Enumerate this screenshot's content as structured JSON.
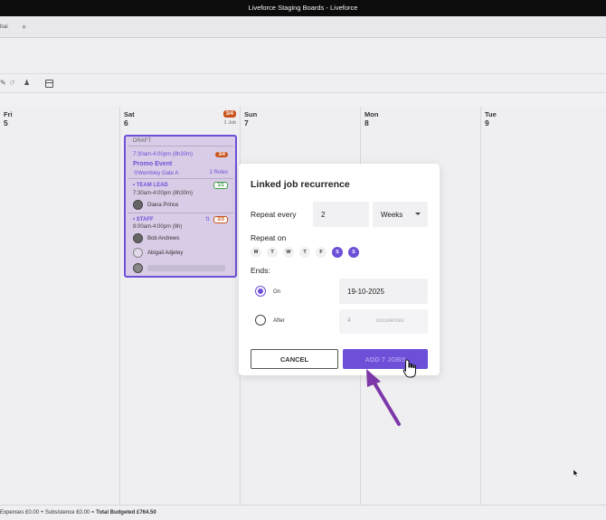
{
  "window": {
    "title": "Liveforce Staging Boards - Liveforce"
  },
  "tabs": [
    {
      "label": "bai"
    }
  ],
  "tab_add_label": "+",
  "calendar": {
    "days": [
      {
        "name": "Fri",
        "num": "5"
      },
      {
        "name": "Sat",
        "num": "6",
        "badge": "3/4",
        "jobs": "1 Job"
      },
      {
        "name": "Sun",
        "num": "7"
      },
      {
        "name": "Mon",
        "num": "8"
      },
      {
        "name": "Tue",
        "num": "9"
      }
    ]
  },
  "event": {
    "status": "DRAFT",
    "time": "7:30am-4:00pm (8h30m)",
    "badge": "3/4",
    "title": "Promo Event",
    "location": "Wembley Gate A",
    "roles": "2 Roles",
    "role1": {
      "name": "• TEAM LEAD",
      "badge": "1/1",
      "time": "7:30am-4:00pm (8h30m)",
      "people": [
        "Diana Prince"
      ]
    },
    "role2": {
      "name": "• STAFF",
      "badge": "2/3",
      "time": "8:00am-4:00pm (8h)",
      "people": [
        "Bob Andrews",
        "Abigail Adjetey"
      ]
    }
  },
  "modal": {
    "title": "Linked job recurrence",
    "repeat_every_label": "Repeat every",
    "repeat_every_value": "2",
    "repeat_unit": "Weeks",
    "repeat_on_label": "Repeat on",
    "weekdays": [
      {
        "letter": "M",
        "selected": false
      },
      {
        "letter": "T",
        "selected": false
      },
      {
        "letter": "W",
        "selected": false
      },
      {
        "letter": "T",
        "selected": false
      },
      {
        "letter": "F",
        "selected": false
      },
      {
        "letter": "S",
        "selected": true
      },
      {
        "letter": "S",
        "selected": true
      }
    ],
    "ends_label": "Ends:",
    "on_label": "On",
    "on_date": "19-10-2025",
    "after_label": "After",
    "occurrences_value": "4",
    "occurrences_unit": "occurences",
    "cancel_label": "CANCEL",
    "add_label": "ADD 7 JOBS"
  },
  "footer": {
    "summary": "Expenses £0.00 + Subsistence £0.00 =",
    "total": "Total Budgeted £764.50"
  },
  "colors": {
    "accent": "#6e4fd8",
    "orange": "#c9541c",
    "green": "#3b9c47"
  }
}
